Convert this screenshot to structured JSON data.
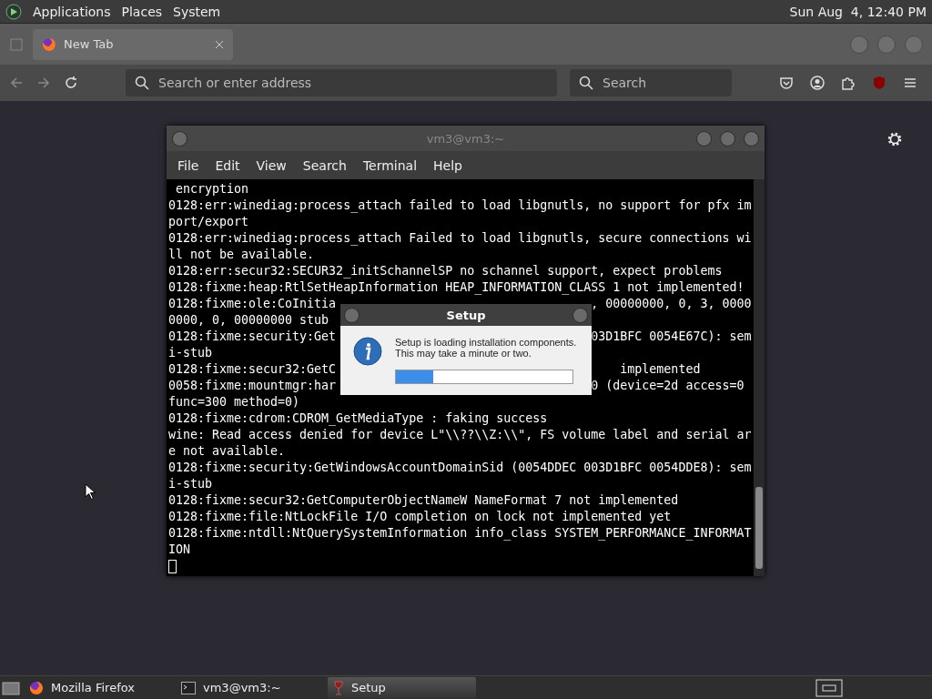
{
  "top_panel": {
    "menus": [
      "Applications",
      "Places",
      "System"
    ],
    "clock": "Sun Aug  4, 12:40 PM"
  },
  "browser": {
    "tabs": [
      {
        "label": "New Tab",
        "selected": true
      }
    ],
    "address": {
      "placeholder": "Search or enter address"
    },
    "search": {
      "placeholder": "Search"
    }
  },
  "terminal": {
    "title": "vm3@vm3:~",
    "menus": [
      "File",
      "Edit",
      "View",
      "Search",
      "Terminal",
      "Help"
    ],
    "lines": [
      {
        "text": " encryption"
      },
      {
        "text": "0128:err:winediag:process_attach failed to load libgnutls, no support for pfx im"
      },
      {
        "text": "port/export"
      },
      {
        "text": "0128:err:winediag:process_attach Failed to load libgnutls, secure connections wi"
      },
      {
        "text": "ll not be available."
      },
      {
        "text": "0128:err:secur32:SECUR32_initSchannelSP no schannel support, expect problems"
      },
      {
        "text": "0128:fixme:heap:RtlSetHeapInformation HEAP_INFORMATION_CLASS 1 not implemented!"
      },
      {
        "text": "0128:fixme:ole:CoInitia",
        "right": ", 00000000, 0, 3, 0000"
      },
      {
        "text": "0000, 0, 00000000 stub"
      },
      {
        "text": "0128:fixme:security:Get",
        "right": "03D1BFC 0054E67C): sem"
      },
      {
        "text": "i-stub"
      },
      {
        "text": "0128:fixme:secur32:GetC",
        "right": "    implemented"
      },
      {
        "text": "0058:fixme:mountmgr:har",
        "right": "0 (device=2d access=0"
      },
      {
        "text": "func=300 method=0)"
      },
      {
        "text": "0128:fixme:cdrom:CDROM_GetMediaType : faking success"
      },
      {
        "text": "wine: Read access denied for device L\"\\\\??\\\\Z:\\\\\", FS volume label and serial ar"
      },
      {
        "text": "e not available."
      },
      {
        "text": "0128:fixme:security:GetWindowsAccountDomainSid (0054DDEC 003D1BFC 0054DDE8): sem"
      },
      {
        "text": "i-stub"
      },
      {
        "text": "0128:fixme:secur32:GetComputerObjectNameW NameFormat 7 not implemented"
      },
      {
        "text": "0128:fixme:file:NtLockFile I/O completion on lock not implemented yet"
      },
      {
        "text": "0128:fixme:ntdll:NtQuerySystemInformation info_class SYSTEM_PERFORMANCE_INFORMAT"
      },
      {
        "text": "ION"
      }
    ]
  },
  "dialog": {
    "title": "Setup",
    "message": "Setup is loading installation components.\nThis may take a minute or two.",
    "progress": {
      "level": 0.21
    }
  },
  "taskbar": {
    "items": [
      {
        "label": "Mozilla Firefox",
        "kind": "firefox",
        "selected": false
      },
      {
        "label": "vm3@vm3:~",
        "kind": "terminal",
        "selected": false
      },
      {
        "label": "Setup",
        "kind": "wine",
        "selected": true
      }
    ]
  }
}
